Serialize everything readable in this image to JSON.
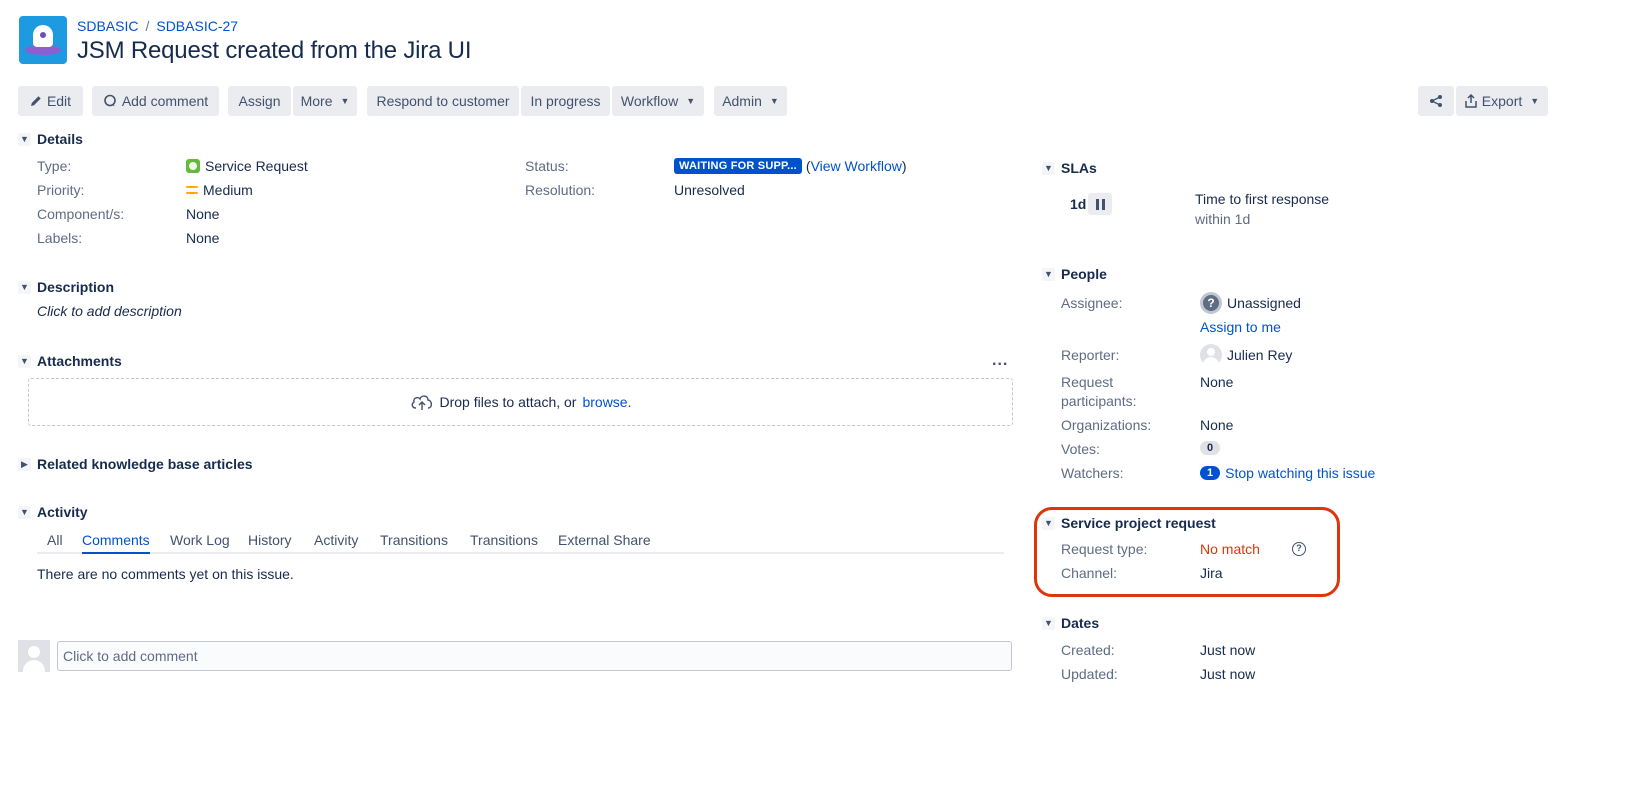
{
  "header": {
    "breadcrumb": [
      "SDBASIC",
      "SDBASIC-27"
    ],
    "breadcrumb_sep": "/",
    "title": "JSM Request created from the Jira UI"
  },
  "toolbar": {
    "edit": "Edit",
    "add_comment": "Add comment",
    "assign": "Assign",
    "more": "More",
    "respond": "Respond to customer",
    "in_progress": "In progress",
    "workflow": "Workflow",
    "admin": "Admin",
    "export": "Export"
  },
  "details": {
    "heading": "Details",
    "type_label": "Type:",
    "type_value": "Service Request",
    "priority_label": "Priority:",
    "priority_value": "Medium",
    "components_label": "Component/s:",
    "components_value": "None",
    "labels_label": "Labels:",
    "labels_value": "None",
    "status_label": "Status:",
    "status_value": "WAITING FOR SUPP...",
    "view_workflow_open": "(",
    "view_workflow": "View Workflow",
    "view_workflow_close": ")",
    "resolution_label": "Resolution:",
    "resolution_value": "Unresolved"
  },
  "description": {
    "heading": "Description",
    "placeholder": "Click to add description"
  },
  "attachments": {
    "heading": "Attachments",
    "more": "...",
    "drop_text": "Drop files to attach, or",
    "browse": "browse."
  },
  "related": {
    "heading": "Related knowledge base articles"
  },
  "activity": {
    "heading": "Activity",
    "tabs": [
      "All",
      "Comments",
      "Work Log",
      "History",
      "Activity",
      "Transitions",
      "Transitions",
      "External Share"
    ],
    "active_tab": "Comments",
    "empty": "There are no comments yet on this issue.",
    "comment_placeholder": "Click to add comment"
  },
  "slas": {
    "heading": "SLAs",
    "time": "1d",
    "name": "Time to first response",
    "goal": "within 1d"
  },
  "people": {
    "heading": "People",
    "assignee_label": "Assignee:",
    "assignee_value": "Unassigned",
    "assign_to_me": "Assign to me",
    "reporter_label": "Reporter:",
    "reporter_value": "Julien Rey",
    "participants_label_1": "Request",
    "participants_label_2": "participants:",
    "participants_value": "None",
    "organizations_label": "Organizations:",
    "organizations_value": "None",
    "votes_label": "Votes:",
    "votes_value": "0",
    "watchers_label": "Watchers:",
    "watchers_value": "1",
    "stop_watching": "Stop watching this issue"
  },
  "service_request": {
    "heading": "Service project request",
    "request_type_label": "Request type:",
    "request_type_value": "No match",
    "help": "?",
    "channel_label": "Channel:",
    "channel_value": "Jira"
  },
  "dates": {
    "heading": "Dates",
    "created_label": "Created:",
    "created_value": "Just now",
    "updated_label": "Updated:",
    "updated_value": "Just now"
  },
  "colors": {
    "link": "#0052cc",
    "status_lozenge": "#0052cc",
    "highlight": "#de350b",
    "no_match": "#de350b",
    "button_bg": "#ebecf0"
  }
}
